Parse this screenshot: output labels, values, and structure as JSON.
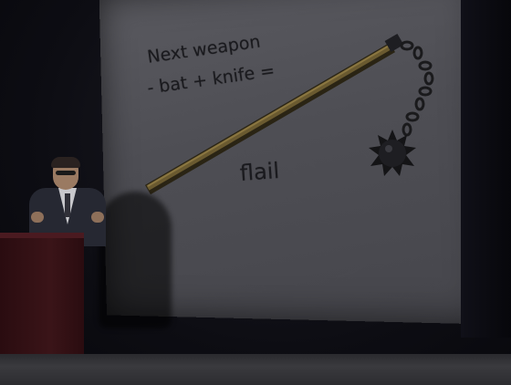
{
  "slide": {
    "line1": "Next weapon",
    "line2": "- bat + knife =",
    "caption": "flail"
  },
  "colors": {
    "slide_background": "#56565c",
    "slide_text": "#1a1a1e",
    "lectern": "#3a1418",
    "stage_floor": "#333337"
  },
  "icons": {
    "weapon": "flail-icon"
  }
}
